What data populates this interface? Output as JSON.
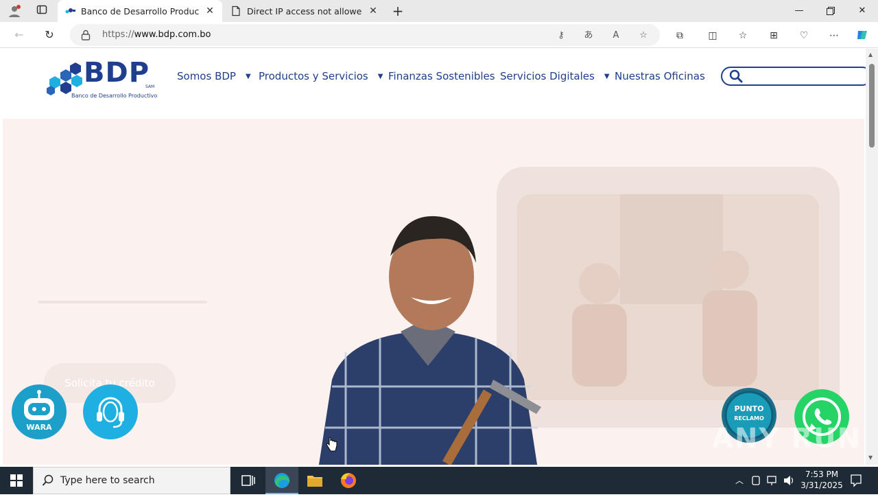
{
  "browser": {
    "tabs": [
      {
        "title": "Banco de Desarrollo Productivo -",
        "active": true
      },
      {
        "title": "Direct IP access not allowed | Clo",
        "active": false
      }
    ],
    "url_prefix": "https://",
    "url_domain": "www.bdp.com.bo"
  },
  "site": {
    "logo_text": "BDP",
    "logo_sam": "SAM",
    "logo_subtitle": "Banco de Desarrollo Productivo",
    "menu": [
      {
        "label": "Somos BDP",
        "has_dropdown": true
      },
      {
        "label": "Productos y Servicios",
        "has_dropdown": true
      },
      {
        "label": "Finanzas Sostenibles",
        "has_dropdown": false
      },
      {
        "label": "Servicios Digitales",
        "has_dropdown": true
      },
      {
        "label": "Nuestras Oficinas",
        "has_dropdown": false
      }
    ],
    "search_placeholder": "",
    "hero_cta": "Solicita tu crédito",
    "float_buttons": {
      "wara_label": "WARA",
      "reclamo_label_1": "PUNTO",
      "reclamo_label_2": "RECLAMO"
    },
    "watermark": "ANY RUN"
  },
  "taskbar": {
    "search_placeholder": "Type here to search",
    "time": "7:53 PM",
    "date": "3/31/2025"
  },
  "colors": {
    "brand_navy": "#1f3e8d",
    "brand_cyan": "#1eb0e0",
    "whatsapp_green": "#25d366",
    "hero_bg": "#fbf1ee"
  }
}
